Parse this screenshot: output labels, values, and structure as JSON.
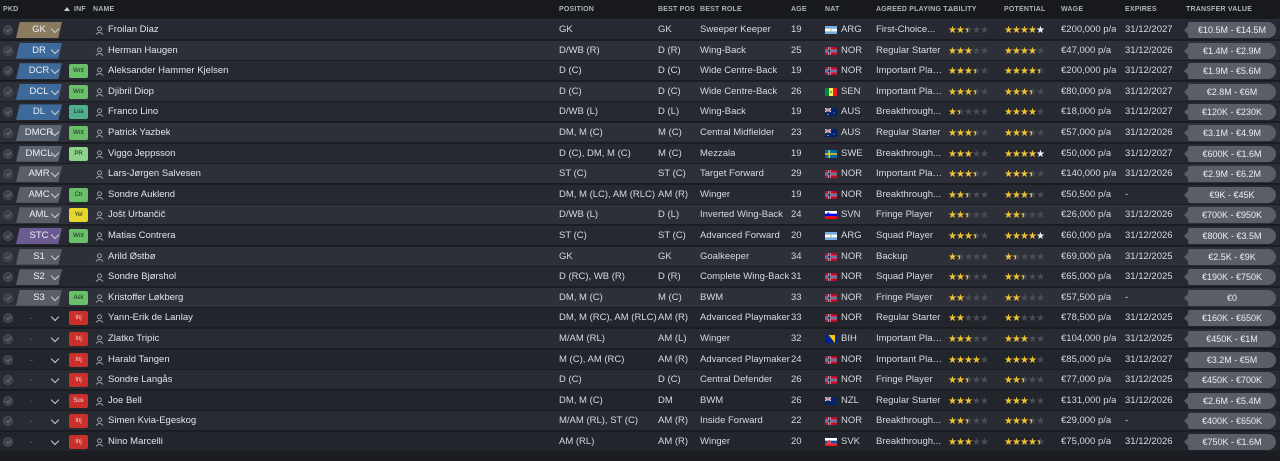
{
  "headers": {
    "pkd": "PKD",
    "inf": "INF",
    "name": "NAME",
    "position": "POSITION",
    "best_pos": "BEST POS",
    "best_role": "BEST ROLE",
    "age": "AGE",
    "nat": "NAT",
    "playing_time": "AGREED PLAYING T...",
    "ability": "ABILITY",
    "potential": "POTENTIAL",
    "wage": "WAGE",
    "expires": "EXPIRES",
    "transfer_value": "TRANSFER VALUE"
  },
  "colors": {
    "star": "#f2c230",
    "star_empty": "#4a4e56",
    "injury": "#c9302c",
    "wanted": "#6abf69",
    "unavailable": "#e6d62b"
  },
  "players": [
    {
      "pkd": "GK",
      "pkd_type": "gk",
      "inf": "",
      "name": "Froilan Diaz",
      "position": "GK",
      "best_pos": "GK",
      "best_role": "Sweeper Keeper",
      "age": "19",
      "nat": "ARG",
      "flag": "flag-argentina",
      "playing_time": "First-Choice...",
      "ability": 2.5,
      "potential": 4.5,
      "pot_white": true,
      "wage": "€200,000 p/a",
      "expires": "31/12/2027",
      "tv": "€10.5M - €14.5M"
    },
    {
      "pkd": "DR",
      "pkd_type": "def",
      "inf": "",
      "name": "Herman Haugen",
      "position": "D/WB (R)",
      "best_pos": "D (R)",
      "best_role": "Wing-Back",
      "age": "25",
      "nat": "NOR",
      "flag": "flag-norway",
      "playing_time": "Regular Starter",
      "ability": 3,
      "potential": 4,
      "pot_white": false,
      "wage": "€47,000 p/a",
      "expires": "31/12/2026",
      "tv": "€1.4M - €2.9M"
    },
    {
      "pkd": "DCR",
      "pkd_type": "def",
      "inf": "Wnt",
      "inf_type": "wnt",
      "name": "Aleksander Hammer Kjelsen",
      "position": "D (C)",
      "best_pos": "D (C)",
      "best_role": "Wide Centre-Back",
      "age": "19",
      "nat": "NOR",
      "flag": "flag-norway",
      "playing_time": "Important Player",
      "ability": 3.5,
      "potential": 4.5,
      "pot_white": false,
      "wage": "€200,000 p/a",
      "expires": "31/12/2027",
      "tv": "€1.9M - €5.6M"
    },
    {
      "pkd": "DCL",
      "pkd_type": "def",
      "inf": "Wnt",
      "inf_type": "wnt",
      "name": "Djibril Diop",
      "position": "D (C)",
      "best_pos": "D (C)",
      "best_role": "Wide Centre-Back",
      "age": "26",
      "nat": "SEN",
      "flag": "flag-senegal",
      "playing_time": "Important Player",
      "ability": 3.5,
      "potential": 3.5,
      "pot_white": false,
      "wage": "€80,000 p/a",
      "expires": "31/12/2027",
      "tv": "€2.8M - €6M"
    },
    {
      "pkd": "DL",
      "pkd_type": "def",
      "inf": "Loa",
      "inf_type": "loa",
      "name": "Franco Lino",
      "position": "D/WB (L)",
      "best_pos": "D (L)",
      "best_role": "Wing-Back",
      "age": "19",
      "nat": "AUS",
      "flag": "flag-australia",
      "playing_time": "Breakthrough...",
      "ability": 1.5,
      "potential": 4,
      "pot_white": true,
      "wage": "€18,000 p/a",
      "expires": "31/12/2027",
      "tv": "€120K - €230K"
    },
    {
      "pkd": "DMCR",
      "pkd_type": "mid",
      "inf": "Wnt",
      "inf_type": "wnt",
      "name": "Patrick Yazbek",
      "position": "DM, M (C)",
      "best_pos": "M (C)",
      "best_role": "Central Midfielder",
      "age": "23",
      "nat": "AUS",
      "flag": "flag-australia",
      "playing_time": "Regular Starter",
      "ability": 3.5,
      "potential": 3.5,
      "pot_white": false,
      "wage": "€57,000 p/a",
      "expires": "31/12/2026",
      "tv": "€3.1M - €4.9M"
    },
    {
      "pkd": "DMCL",
      "pkd_type": "mid",
      "inf": "PR",
      "inf_type": "pr",
      "name": "Viggo Jeppsson",
      "position": "D (C), DM, M (C)",
      "best_pos": "M (C)",
      "best_role": "Mezzala",
      "age": "19",
      "nat": "SWE",
      "flag": "flag-sweden",
      "playing_time": "Breakthrough...",
      "ability": 3,
      "potential": 4.5,
      "pot_white": true,
      "wage": "€50,000 p/a",
      "expires": "31/12/2027",
      "tv": "€600K - €1.6M"
    },
    {
      "pkd": "AMR",
      "pkd_type": "sub",
      "inf": "",
      "name": "Lars-Jørgen Salvesen",
      "position": "ST (C)",
      "best_pos": "ST (C)",
      "best_role": "Target Forward",
      "age": "29",
      "nat": "NOR",
      "flag": "flag-norway",
      "playing_time": "Important Player",
      "ability": 3.5,
      "potential": 3.5,
      "pot_white": false,
      "wage": "€140,000 p/a",
      "expires": "31/12/2026",
      "tv": "€2.9M - €6.2M"
    },
    {
      "pkd": "AMC",
      "pkd_type": "sub",
      "inf": "Ctr",
      "inf_type": "ctr",
      "name": "Sondre Auklend",
      "position": "DM, M (LC), AM (RLC)",
      "best_pos": "AM (R)",
      "best_role": "Winger",
      "age": "19",
      "nat": "NOR",
      "flag": "flag-norway",
      "playing_time": "Breakthrough...",
      "ability": 2.5,
      "potential": 3.5,
      "pot_white": false,
      "wage": "€50,500 p/a",
      "expires": "-",
      "tv": "€9K - €45K"
    },
    {
      "pkd": "AML",
      "pkd_type": "sub",
      "inf": "Yel",
      "inf_type": "yel",
      "name": "Jošt Urbančič",
      "position": "D/WB (L)",
      "best_pos": "D (L)",
      "best_role": "Inverted Wing-Back",
      "age": "24",
      "nat": "SVN",
      "flag": "flag-slovenia",
      "playing_time": "Fringe Player",
      "ability": 2.5,
      "potential": 2.5,
      "pot_white": false,
      "wage": "€26,000 p/a",
      "expires": "31/12/2026",
      "tv": "€700K - €950K"
    },
    {
      "pkd": "STC",
      "pkd_type": "att",
      "inf": "Wnt",
      "inf_type": "wnt",
      "name": "Matias Contrera",
      "position": "ST (C)",
      "best_pos": "ST (C)",
      "best_role": "Advanced Forward",
      "age": "20",
      "nat": "ARG",
      "flag": "flag-argentina",
      "playing_time": "Squad Player",
      "ability": 3.5,
      "potential": 4.5,
      "pot_white": true,
      "wage": "€60,000 p/a",
      "expires": "31/12/2026",
      "tv": "€800K - €3.5M"
    },
    {
      "pkd": "S1",
      "pkd_type": "sub",
      "inf": "",
      "name": "Arild Østbø",
      "position": "GK",
      "best_pos": "GK",
      "best_role": "Goalkeeper",
      "age": "34",
      "nat": "NOR",
      "flag": "flag-norway",
      "playing_time": "Backup",
      "ability": 1.5,
      "potential": 1.5,
      "pot_white": false,
      "wage": "€69,000 p/a",
      "expires": "31/12/2025",
      "tv": "€2.5K - €9K"
    },
    {
      "pkd": "S2",
      "pkd_type": "sub",
      "inf": "",
      "name": "Sondre Bjørshol",
      "position": "D (RC), WB (R)",
      "best_pos": "D (R)",
      "best_role": "Complete Wing-Back",
      "age": "31",
      "nat": "NOR",
      "flag": "flag-norway",
      "playing_time": "Squad Player",
      "ability": 2.5,
      "potential": 2.5,
      "pot_white": false,
      "wage": "€65,000 p/a",
      "expires": "31/12/2025",
      "tv": "€190K - €750K"
    },
    {
      "pkd": "S3",
      "pkd_type": "sub",
      "inf": "Ask",
      "inf_type": "ask",
      "name": "Kristoffer Løkberg",
      "position": "DM, M (C)",
      "best_pos": "M (C)",
      "best_role": "BWM",
      "age": "33",
      "nat": "NOR",
      "flag": "flag-norway",
      "playing_time": "Fringe Player",
      "ability": 2,
      "potential": 2,
      "pot_white": false,
      "wage": "€57,500 p/a",
      "expires": "-",
      "tv": "€0"
    },
    {
      "pkd": "",
      "pkd_type": "none",
      "inf": "Inj",
      "inf_type": "inj",
      "name": "Yann-Erik de Lanlay",
      "position": "DM, M (RC), AM (RLC)",
      "best_pos": "AM (R)",
      "best_role": "Advanced Playmaker",
      "age": "33",
      "nat": "NOR",
      "flag": "flag-norway",
      "playing_time": "Regular Starter",
      "ability": 2,
      "potential": 2,
      "pot_white": false,
      "wage": "€78,500 p/a",
      "expires": "31/12/2025",
      "tv": "€160K - €650K"
    },
    {
      "pkd": "",
      "pkd_type": "none",
      "inf": "Inj",
      "inf_type": "inj",
      "name": "Zlatko Tripic",
      "position": "M/AM (RL)",
      "best_pos": "AM (L)",
      "best_role": "Winger",
      "age": "32",
      "nat": "BIH",
      "flag": "flag-bosnia",
      "playing_time": "Important Player",
      "ability": 3,
      "potential": 3,
      "pot_white": false,
      "wage": "€104,000 p/a",
      "expires": "31/12/2025",
      "tv": "€450K - €1M"
    },
    {
      "pkd": "",
      "pkd_type": "none",
      "inf": "Inj",
      "inf_type": "inj",
      "name": "Harald Tangen",
      "position": "M (C), AM (RC)",
      "best_pos": "AM (R)",
      "best_role": "Advanced Playmaker",
      "age": "24",
      "nat": "NOR",
      "flag": "flag-norway",
      "playing_time": "Important Player",
      "ability": 4,
      "potential": 4,
      "pot_white": false,
      "wage": "€85,000 p/a",
      "expires": "31/12/2027",
      "tv": "€3.2M - €5M"
    },
    {
      "pkd": "",
      "pkd_type": "none",
      "inf": "Inj",
      "inf_type": "inj",
      "name": "Sondre Langås",
      "position": "D (C)",
      "best_pos": "D (C)",
      "best_role": "Central Defender",
      "age": "26",
      "nat": "NOR",
      "flag": "flag-norway",
      "playing_time": "Fringe Player",
      "ability": 2.5,
      "potential": 2.5,
      "pot_white": false,
      "wage": "€77,000 p/a",
      "expires": "31/12/2025",
      "tv": "€450K - €700K"
    },
    {
      "pkd": "",
      "pkd_type": "none",
      "inf": "Sus",
      "inf_type": "sus",
      "name": "Joe Bell",
      "position": "DM, M (C)",
      "best_pos": "DM",
      "best_role": "BWM",
      "age": "26",
      "nat": "NZL",
      "flag": "flag-new-zealand",
      "playing_time": "Regular Starter",
      "ability": 3,
      "potential": 3,
      "pot_white": false,
      "wage": "€131,000 p/a",
      "expires": "31/12/2026",
      "tv": "€2.6M - €5.4M"
    },
    {
      "pkd": "",
      "pkd_type": "none",
      "inf": "Inj",
      "inf_type": "inj",
      "name": "Simen Kvia-Egeskog",
      "position": "M/AM (RL), ST (C)",
      "best_pos": "AM (R)",
      "best_role": "Inside Forward",
      "age": "22",
      "nat": "NOR",
      "flag": "flag-norway",
      "playing_time": "Breakthrough...",
      "ability": 2.5,
      "potential": 3.5,
      "pot_white": false,
      "wage": "€29,000 p/a",
      "expires": "-",
      "tv": "€400K - €650K"
    },
    {
      "pkd": "",
      "pkd_type": "none",
      "inf": "Inj",
      "inf_type": "inj",
      "name": "Nino Marcelli",
      "position": "AM (RL)",
      "best_pos": "AM (R)",
      "best_role": "Winger",
      "age": "20",
      "nat": "SVK",
      "flag": "flag-slovakia",
      "playing_time": "Breakthrough...",
      "ability": 3,
      "potential": 4.5,
      "pot_white": false,
      "wage": "€75,000 p/a",
      "expires": "31/12/2026",
      "tv": "€750K - €1.6M"
    }
  ]
}
